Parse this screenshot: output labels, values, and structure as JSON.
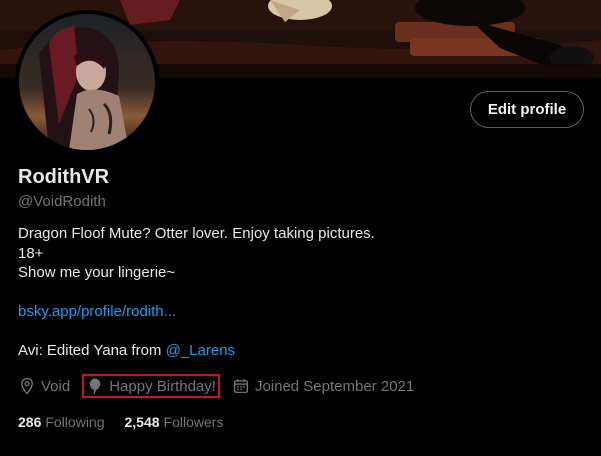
{
  "colors": {
    "background": "#000000",
    "primary_text": "#e7e9ea",
    "secondary_text": "#71767b",
    "link": "#1d9bf0",
    "highlight_border": "#c4161c",
    "button_border": "#536471"
  },
  "profile": {
    "edit_button_label": "Edit profile",
    "display_name": "RodithVR",
    "handle": "@VoidRodith"
  },
  "bio": {
    "line1": "Dragon Floof Mute? Otter lover. Enjoy taking pictures.",
    "line2": "18+",
    "line3": "Show me your lingerie~",
    "link": "bsky.app/profile/rodith...",
    "avi_prefix": "Avi: Edited Yana from",
    "avi_mention": "@_Larens"
  },
  "meta": {
    "location": "Void",
    "location_icon": "location-pin-icon",
    "birthday": "Happy Birthday!",
    "birthday_icon": "balloon-icon",
    "joined": "Joined September 2021",
    "joined_icon": "calendar-icon"
  },
  "stats": {
    "following_count": "286",
    "following_label": "Following",
    "followers_count": "2,548",
    "followers_label": "Followers"
  }
}
